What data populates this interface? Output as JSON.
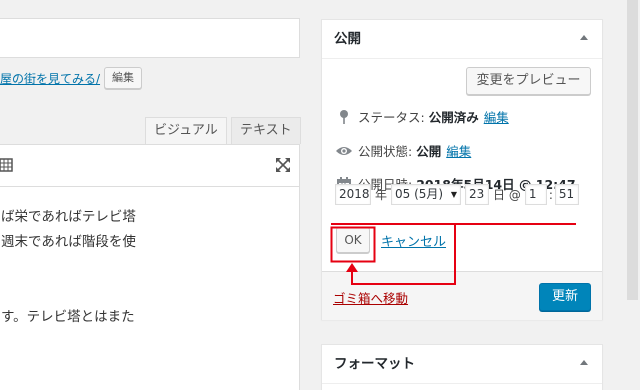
{
  "editor": {
    "permalink_text": "屋の街を見てみる/",
    "permalink_edit": "編集",
    "tabs": [
      "ビジュアル",
      "テキスト"
    ],
    "body_lines": [
      "ば栄であればテレビ塔",
      "週末であれば階段を使",
      "",
      "",
      "す。テレビ塔とはまた"
    ]
  },
  "publish": {
    "title": "公開",
    "preview_label": "変更をプレビュー",
    "status_label": "ステータス:",
    "status_value": "公開済み",
    "status_edit": "編集",
    "visibility_label": "公開状態:",
    "visibility_value": "公開",
    "visibility_edit": "編集",
    "date_label": "公開日時:",
    "date_value": "2018年5月14日 @ 12:47",
    "fields": {
      "year": "2018",
      "year_unit": "年",
      "month": "05 (5月)",
      "day": "23",
      "day_unit": "日 @",
      "hour": "1",
      "colon": ":",
      "minute": "51"
    },
    "ok_label": "OK",
    "cancel_label": "キャンセル",
    "trash_label": "ゴミ箱へ移動",
    "update_label": "更新"
  },
  "format": {
    "title": "フォーマット"
  },
  "colors": {
    "accent": "#0073aa",
    "primary_button": "#0085ba",
    "trash": "#a00",
    "annotation": "#e60012"
  }
}
